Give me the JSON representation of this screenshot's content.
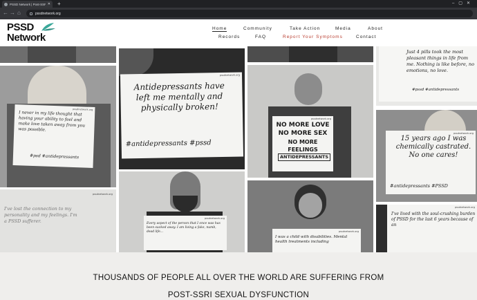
{
  "browser": {
    "tab_title": "PSSD Network | Post-SSRI Sexu...",
    "new_tab": "+",
    "url": "pssdnetwork.org"
  },
  "header": {
    "logo_line1": "PSSD",
    "logo_line2": "Network",
    "nav_row1": [
      "Home",
      "Community",
      "Take Action",
      "Media",
      "About"
    ],
    "nav_row2": [
      "Records",
      "FAQ",
      "Report Your Symptoms",
      "Contact"
    ],
    "accent_color": "#b83a2c"
  },
  "photos": {
    "p1": {
      "url": "pssdnetwork.org",
      "text": "I never in my life thought that having your ability to feel and make love taken away from you was possible.",
      "tags": "#psd   #antidepressants"
    },
    "p2": {
      "url": "pssdnetwork.org",
      "text": "I've lost the connection to my personality and my feelings. I'm a PSSD sufferer."
    },
    "p3": {
      "url": "pssdnetwork.org",
      "text": "Antidepressants have left me mentally and physically broken!",
      "tags": "#antidepressants   #pssd"
    },
    "p4": {
      "url": "pssdnetwork.org",
      "text": "Every aspect of the person that I once was has been sucked away. I am living a fake, numb, dead life..."
    },
    "p5": {
      "url": "pssdnetwork.org",
      "line1": "NO MORE LOVE",
      "line2": "NO MORE SEX",
      "line3": "NO MORE FEELINGS",
      "line4": "ANTIDEPRESSANTS"
    },
    "p6": {
      "url": "pssdnetwork.org",
      "text": "I was a child with disabilities. Mental health treatments including"
    },
    "p7": {
      "text": "Just 4 pills took the most pleasant things in life from me. Nothing is like before, no emotions, no love.",
      "tags": "#pssd   #antidepressants"
    },
    "p8": {
      "url": "pssdnetwork.org",
      "text": "15 years ago I was chemically castrated. No one cares!",
      "tags": "#antidepressants  #PSSD"
    },
    "p9": {
      "url": "pssdnetwork.org",
      "text": "I've lived with the soul-crushing burden of PSSD for the last 6 years because of an"
    }
  },
  "hero": {
    "line1": "THOUSANDS OF PEOPLE ALL OVER THE WORLD ARE SUFFERING FROM",
    "line2": "POST-SSRI SEXUAL DYSFUNCTION"
  }
}
